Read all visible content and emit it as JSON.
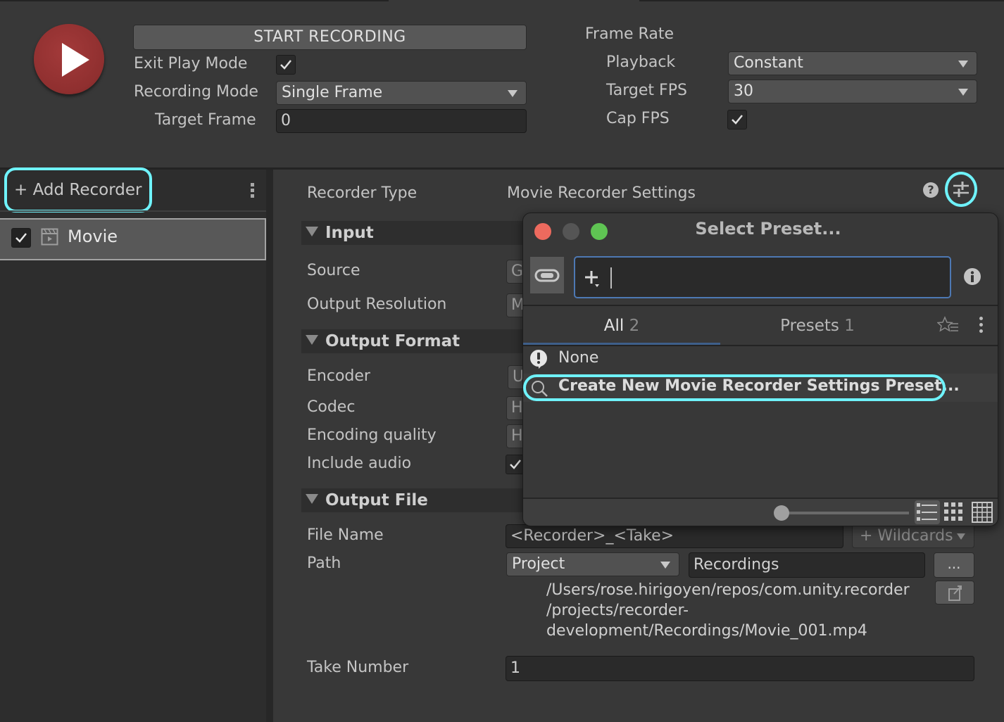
{
  "header": {
    "start_recording": "START RECORDING",
    "exit_play_mode_label": "Exit Play Mode",
    "exit_play_mode_checked": true,
    "recording_mode_label": "Recording Mode",
    "recording_mode_value": "Single Frame",
    "target_frame_label": "Target Frame",
    "target_frame_value": "0",
    "frame_rate_label": "Frame Rate",
    "playback_label": "Playback",
    "playback_value": "Constant",
    "target_fps_label": "Target FPS",
    "target_fps_value": "30",
    "cap_fps_label": "Cap FPS",
    "cap_fps_checked": true
  },
  "sidebar": {
    "add_recorder": "+ Add Recorder",
    "recorders": [
      {
        "label": "Movie",
        "enabled": true,
        "icon": "movie-clapper-icon"
      }
    ]
  },
  "inspector": {
    "recorder_type_label": "Recorder Type",
    "recorder_type_value": "Movie Recorder Settings",
    "sections": {
      "input": {
        "title": "Input",
        "fields": [
          {
            "label": "Source",
            "value_visible": "G"
          },
          {
            "label": "Output Resolution",
            "value_visible": "M"
          }
        ]
      },
      "output_format": {
        "title": "Output Format",
        "fields": [
          {
            "label": "Encoder",
            "value_visible": "U"
          },
          {
            "label": "Codec",
            "value_visible": "H"
          },
          {
            "label": "Encoding quality",
            "value_visible": "H"
          },
          {
            "label": "Include audio",
            "checked": true
          }
        ]
      },
      "output_file": {
        "title": "Output File",
        "file_name_label": "File Name",
        "file_name_value": "<Recorder>_<Take>",
        "wildcards_label": "+ Wildcards",
        "path_label": "Path",
        "path_root": "Project",
        "path_folder": "Recordings",
        "browse_label": "...",
        "full_path": "/Users/rose.hirigoyen/repos/com.unity.recorder\n/projects/recorder-\ndevelopment/Recordings/Movie_001.mp4",
        "take_number_label": "Take Number",
        "take_number_value": "1"
      }
    }
  },
  "preset_popup": {
    "title": "Select Preset...",
    "search_value": "",
    "tabs": [
      {
        "label": "All",
        "count": "2",
        "active": true
      },
      {
        "label": "Presets",
        "count": "1",
        "active": false
      }
    ],
    "items": [
      {
        "label": "None",
        "icon": "warning-icon"
      },
      {
        "label": "Create New Movie Recorder Settings Preset...",
        "icon": "search-icon"
      }
    ],
    "zoom_level": 0
  },
  "colors": {
    "highlight": "#6ff3fb",
    "focus_border": "#4d78b3",
    "record_red": "#9b3434",
    "traffic_red": "#ed6a5e",
    "traffic_gray": "#555555",
    "traffic_green": "#5fc453"
  }
}
